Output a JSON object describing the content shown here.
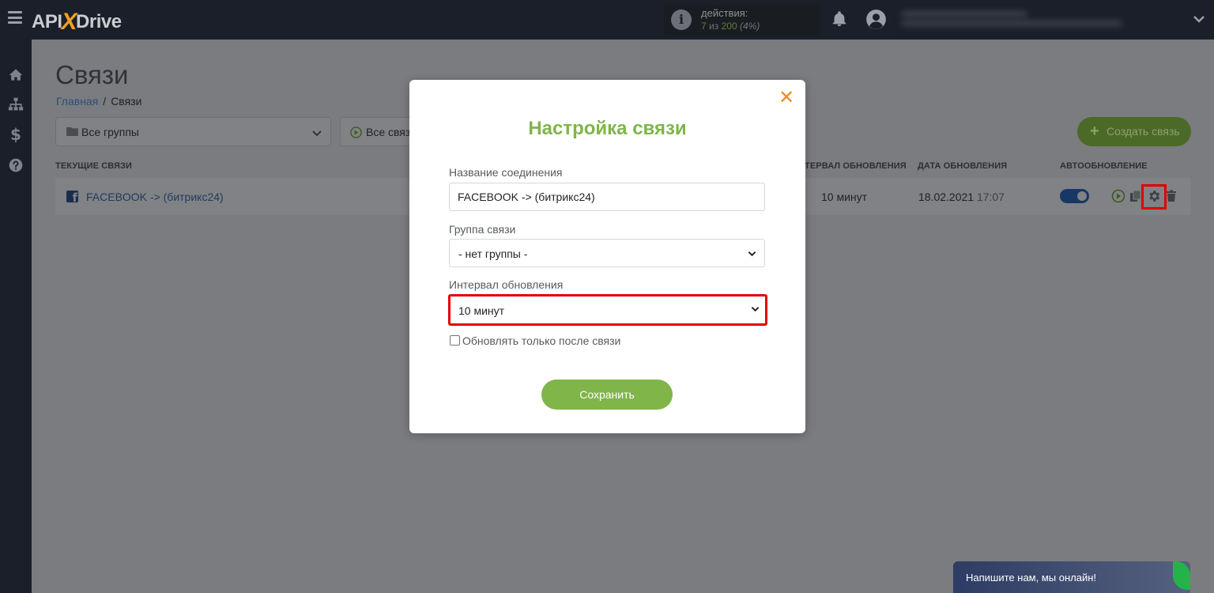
{
  "header": {
    "logo": {
      "part1": "API",
      "part2": "X",
      "part3": "Drive"
    },
    "actions": {
      "label": "действия:",
      "used": "7",
      "of": "из",
      "total": "200",
      "percent": "(4%)"
    }
  },
  "page": {
    "title": "Связи",
    "breadcrumb": {
      "home": "Главная",
      "separator": "/",
      "current": "Связи"
    }
  },
  "filters": {
    "groups_label": "Все группы",
    "status_label": "Все связи"
  },
  "create_button": {
    "label": "Создать связь"
  },
  "table": {
    "columns": {
      "current": "ТЕКУЩИЕ СВЯЗИ",
      "interval": "ТЕРВАЛ ОБНОВЛЕНИЯ",
      "date": "ДАТА ОБНОВЛЕНИЯ",
      "auto": "АВТООБНОВЛЕНИЕ"
    },
    "rows": [
      {
        "name": "FACEBOOK -> (битрикс24)",
        "interval": "10 минут",
        "date": "18.02.2021",
        "time": "17:07",
        "autoupdate": true
      }
    ]
  },
  "modal": {
    "title": "Настройка связи",
    "name_label": "Название соединения",
    "name_value": "FACEBOOK -> (битрикс24)",
    "group_label": "Группа связи",
    "group_value": "- нет группы -",
    "interval_label": "Интервал обновления",
    "interval_value": "10 минут",
    "checkbox_label": "Обновлять только после связи",
    "checkbox_checked": false,
    "save_label": "Сохранить"
  },
  "chat": {
    "label": "Напишите нам, мы онлайн!"
  },
  "colors": {
    "accent_green": "#80b54a",
    "title_green": "#7fb54b",
    "close_orange": "#f08a1c",
    "highlight_red": "#e30000",
    "topbar": "#1a1f29"
  },
  "icons": {
    "sidebar": [
      "home-icon",
      "sitemap-icon",
      "dollar-icon",
      "help-icon"
    ],
    "row_actions": [
      "play-icon",
      "copy-icon",
      "gear-icon",
      "trash-icon"
    ]
  }
}
